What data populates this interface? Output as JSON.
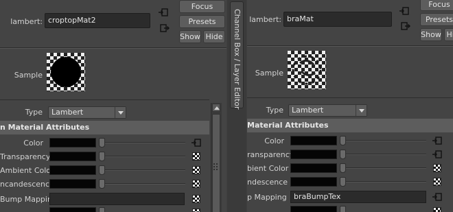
{
  "divider": {
    "tab_label": "Channel Box / Layer Editor"
  },
  "left": {
    "node_type_label": "lambert:",
    "node_name": "croptopMat2",
    "buttons": {
      "focus": "Focus",
      "presets": "Presets",
      "show": "Show",
      "hide": "Hide"
    },
    "sample_label": "Sample",
    "type_label": "Type",
    "type_value": "Lambert",
    "section_title": "n Material Attributes",
    "attributes": [
      {
        "label": "Color"
      },
      {
        "label": "Transparency"
      },
      {
        "label": "Ambient Color"
      },
      {
        "label": "ncandescence"
      }
    ],
    "bump_label": "Bump Mapping",
    "bump_value": ""
  },
  "right": {
    "node_type_label": "lambert:",
    "node_name": "braMat",
    "buttons": {
      "focus": "Focus",
      "presets": "Presets",
      "show": "Show",
      "hide": "Hide"
    },
    "sample_label": "Sample",
    "type_label": "Type",
    "type_value": "Lambert",
    "section_title": "Material Attributes",
    "attributes": [
      {
        "label": "Color"
      },
      {
        "label": "ransparency"
      },
      {
        "label": "bient Color"
      },
      {
        "label": "ndescence"
      }
    ],
    "bump_label": "p Mapping",
    "bump_value": "braBumpTex"
  },
  "colors": {
    "panel_bg": "#444444",
    "field_bg": "#2b2b2b",
    "button_bg": "#5d5d5d",
    "color_swatch": "#050505"
  }
}
